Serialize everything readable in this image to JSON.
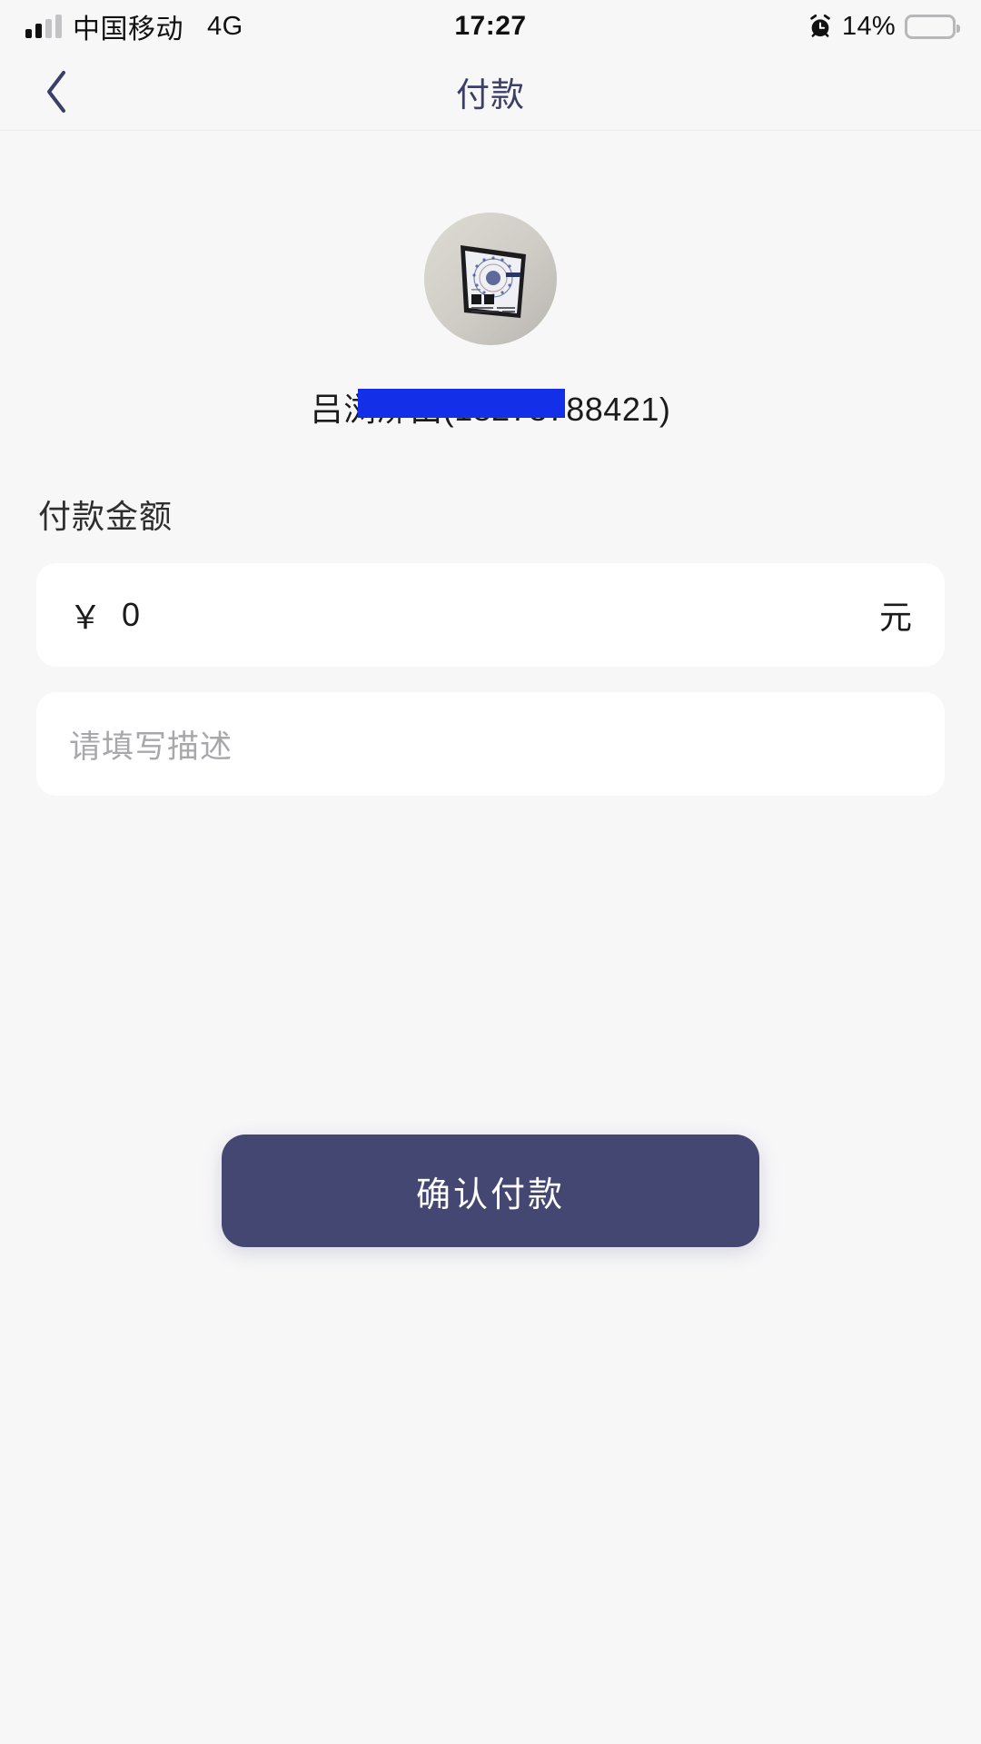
{
  "status_bar": {
    "carrier": "中国移动",
    "network": "4G",
    "time": "17:27",
    "battery_percent": "14%",
    "signal_icon": "signal-bars-icon",
    "alarm_icon": "alarm-clock-icon",
    "battery_icon": "battery-low-icon"
  },
  "nav": {
    "back_icon": "chevron-left-icon",
    "title": "付款"
  },
  "payee": {
    "avatar_icon": "payee-avatar-photo",
    "name_line": "吕浏泖由(18278788421)",
    "name_prefix": "吕",
    "name_suffix": "21)",
    "redacted": true
  },
  "amount_section": {
    "label": "付款金额",
    "currency_symbol": "￥",
    "value": "0",
    "unit": "元"
  },
  "description_section": {
    "placeholder": "请填写描述",
    "value": ""
  },
  "actions": {
    "confirm_label": "确认付款"
  },
  "colors": {
    "page_bg": "#f7f7f8",
    "card_bg": "#ffffff",
    "nav_title": "#3b3f68",
    "primary_button": "#434771",
    "redaction": "#1330e8",
    "battery_low": "#f5342b",
    "placeholder": "#a8a8ac"
  }
}
